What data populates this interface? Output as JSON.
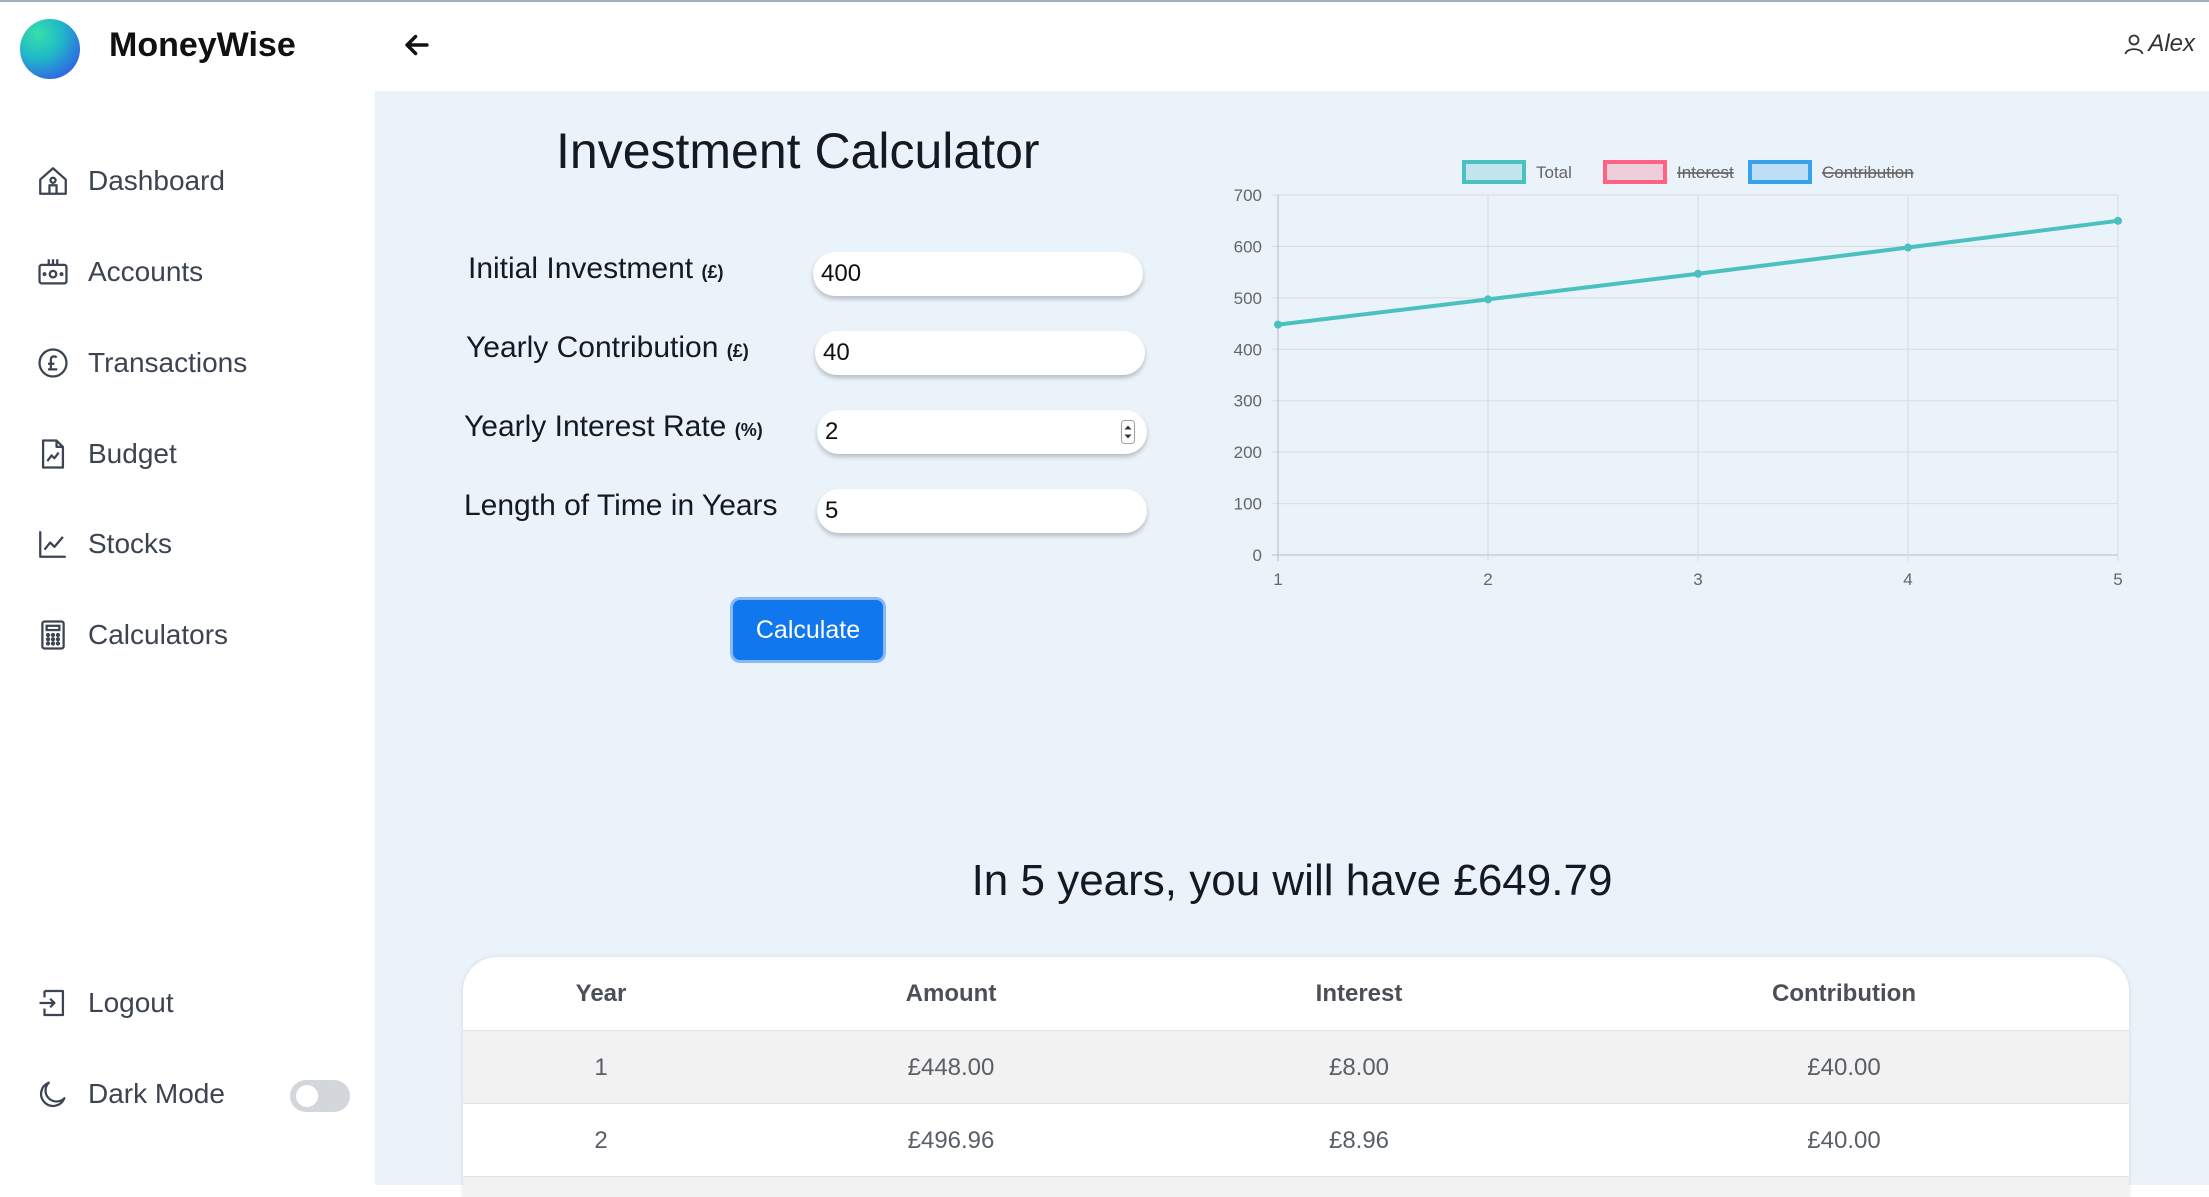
{
  "app": {
    "name": "MoneyWise",
    "user": "Alex"
  },
  "sidebar": {
    "items": [
      {
        "label": "Dashboard",
        "icon": "home-icon"
      },
      {
        "label": "Accounts",
        "icon": "wallet-icon"
      },
      {
        "label": "Transactions",
        "icon": "pound-coin-icon"
      },
      {
        "label": "Budget",
        "icon": "budget-document-icon"
      },
      {
        "label": "Stocks",
        "icon": "stocks-chart-icon"
      },
      {
        "label": "Calculators",
        "icon": "calculator-icon"
      }
    ],
    "logout": "Logout",
    "dark_mode": "Dark Mode",
    "dark_mode_on": false
  },
  "calculator": {
    "title": "Investment Calculator",
    "fields": {
      "initial": {
        "label": "Initial Investment",
        "unit": "(£)",
        "value": "400"
      },
      "contribution": {
        "label": "Yearly Contribution",
        "unit": "(£)",
        "value": "40"
      },
      "rate": {
        "label": "Yearly Interest Rate",
        "unit": "(%)",
        "value": "2"
      },
      "years": {
        "label": "Length of Time in Years",
        "value": "5"
      }
    },
    "button": "Calculate",
    "result": "In 5 years, you will have £649.79"
  },
  "chart_data": {
    "type": "line",
    "x": [
      1,
      2,
      3,
      4,
      5
    ],
    "series": [
      {
        "name": "Total",
        "values": [
          448.0,
          496.96,
          546.9,
          597.84,
          649.79
        ],
        "color": "#4bc0c0",
        "hidden": false
      },
      {
        "name": "Interest",
        "values": [],
        "color": "#ff6384",
        "hidden": true
      },
      {
        "name": "Contribution",
        "values": [],
        "color": "#36a2eb",
        "hidden": true
      }
    ],
    "ylim": [
      0,
      700
    ],
    "yticks": [
      0,
      100,
      200,
      300,
      400,
      500,
      600,
      700
    ],
    "xticks": [
      1,
      2,
      3,
      4,
      5
    ],
    "grid": true,
    "legend": "top-center"
  },
  "table": {
    "headers": [
      "Year",
      "Amount",
      "Interest",
      "Contribution"
    ],
    "rows": [
      [
        "1",
        "£448.00",
        "£8.00",
        "£40.00"
      ],
      [
        "2",
        "£496.96",
        "£8.96",
        "£40.00"
      ]
    ]
  }
}
